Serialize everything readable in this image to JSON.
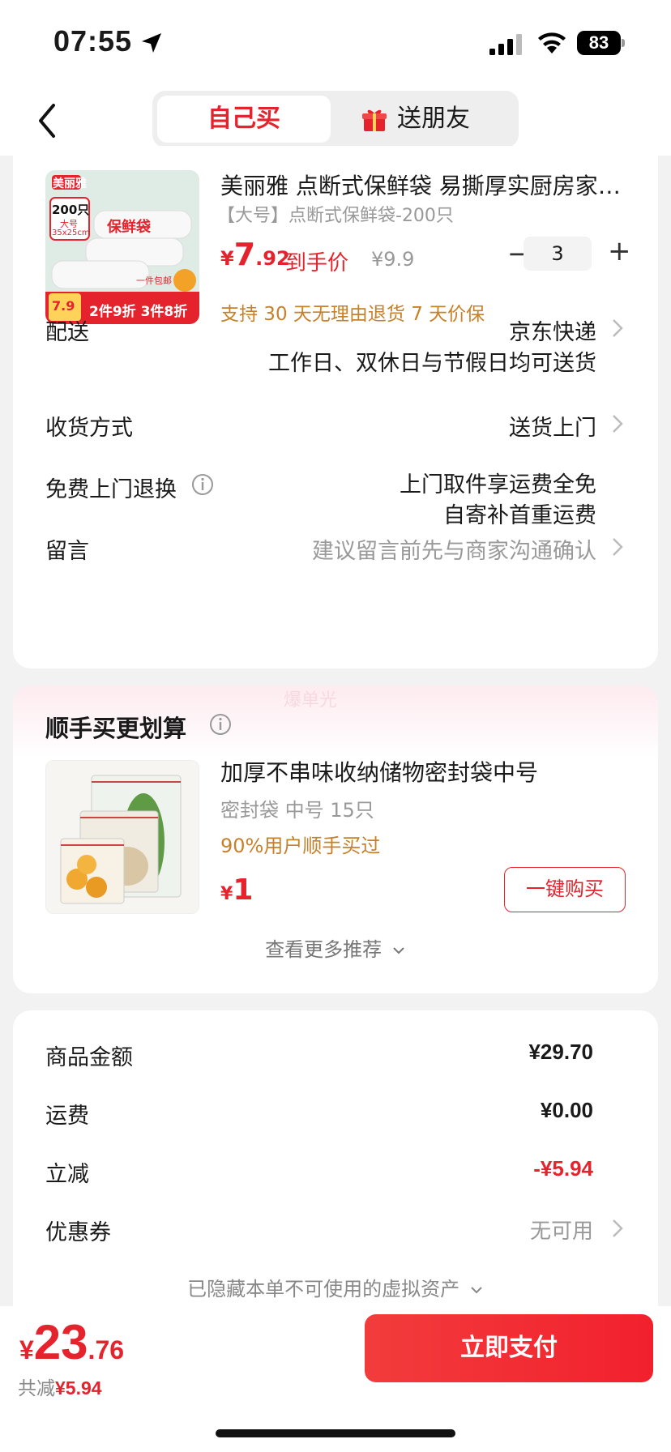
{
  "status_bar": {
    "time": "07:55",
    "battery": "83"
  },
  "header": {
    "tabs": [
      {
        "label": "自己买",
        "active": true
      },
      {
        "label": "送朋友",
        "active": false
      }
    ]
  },
  "product": {
    "title": "美丽雅 点断式保鲜袋 易撕厚实厨房家用食品袋",
    "spec": "【大号】点断式保鲜袋-200只",
    "price_yen": "¥",
    "price_int": "7",
    "price_dec": ".92",
    "price_tag": "到手价",
    "original_price": "¥9.9",
    "quantity": "3",
    "qty_minus": "−",
    "qty_plus": "+",
    "service": "支持 30 天无理由退货   7 天价保",
    "thumb": {
      "count": "200只",
      "size_label": "大号",
      "size": "35x25cm",
      "brand": "美丽雅",
      "name": "保鲜袋",
      "promo_price": "7.9",
      "promo": "2件9折 3件8折",
      "ship": "一件包邮"
    }
  },
  "details": {
    "delivery_label": "配送",
    "delivery_value": "京东快递",
    "delivery_sub": "工作日、双休日与节假日均可送货",
    "receive_label": "收货方式",
    "receive_value": "送货上门",
    "return_label": "免费上门退换",
    "return_value_1": "上门取件享运费全免",
    "return_value_2": "自寄补首重运费",
    "note_label": "留言",
    "note_placeholder": "建议留言前先与商家沟通确认"
  },
  "recommend": {
    "watermark": "爆单光",
    "title": "顺手买更划算",
    "item_name": "加厚不串味收纳储物密封袋中号",
    "item_spec": "密封袋 中号 15只",
    "item_pct": "90%用户顺手买过",
    "price_yen": "¥",
    "price_int": "1",
    "buy_label": "一键购买",
    "more_label": "查看更多推荐"
  },
  "summary": {
    "goods_label": "商品金额",
    "goods_value": "¥29.70",
    "shipping_label": "运费",
    "shipping_value": "¥0.00",
    "discount_label": "立减",
    "discount_value": "-¥5.94",
    "coupon_label": "优惠券",
    "coupon_value": "无可用",
    "hidden_label": "已隐藏本单不可使用的虚拟资产"
  },
  "footer": {
    "total_yen": "¥",
    "total_int": "23",
    "total_dec": ".76",
    "saved_prefix": "共减",
    "saved_amount": "¥5.94",
    "pay_label": "立即支付"
  },
  "colors": {
    "accent": "#e5232d",
    "service": "#c7812a",
    "muted": "#999999"
  }
}
